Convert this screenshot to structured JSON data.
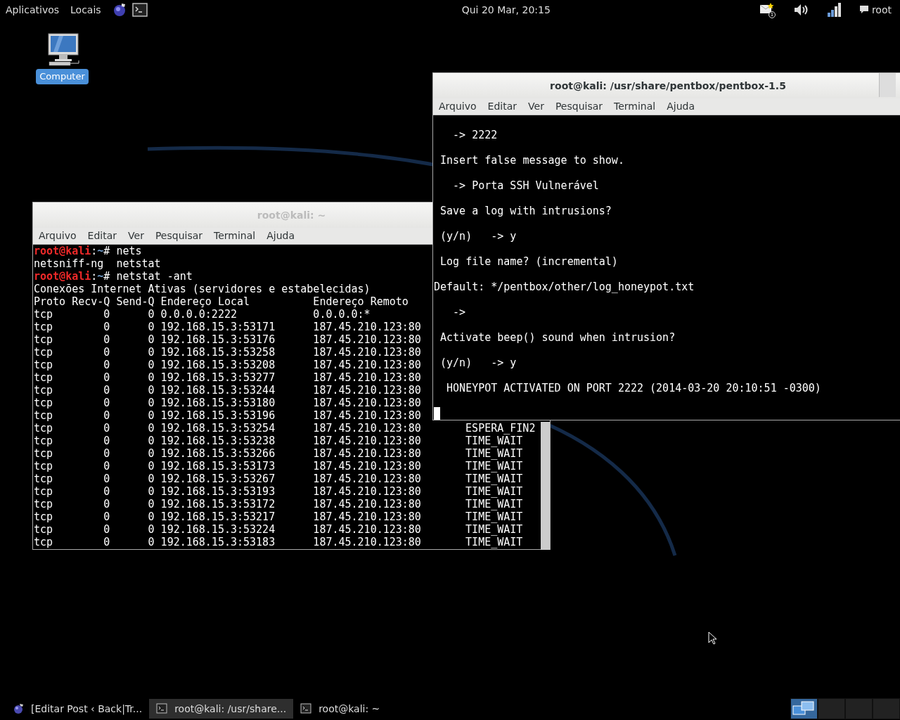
{
  "top_bar": {
    "menus": [
      {
        "label": "Aplicativos"
      },
      {
        "label": "Locais"
      }
    ],
    "clock": "Qui 20 Mar, 20:15",
    "mail_badge": "1",
    "user": "root"
  },
  "desktop_icons": [
    {
      "label": "Computer",
      "selected": true
    }
  ],
  "windows": [
    {
      "title": "root@kali: ~",
      "focused": false,
      "menu": [
        "Arquivo",
        "Editar",
        "Ver",
        "Pesquisar",
        "Terminal",
        "Ajuda"
      ],
      "cursor": false,
      "lines": [
        {
          "kind": "prompt",
          "user": "root@kali",
          "sep": ":",
          "path": "~",
          "symbol": "#",
          "command": " nets"
        },
        {
          "kind": "output",
          "text": "netsniff-ng  netstat"
        },
        {
          "kind": "prompt",
          "user": "root@kali",
          "sep": ":",
          "path": "~",
          "symbol": "#",
          "command": " netstat -ant"
        },
        {
          "kind": "output",
          "text": "Conexões Internet Ativas (servidores e estabelecidas)"
        },
        {
          "kind": "output",
          "text": "Proto Recv-Q Send-Q Endereço Local          Endereço Remoto"
        },
        {
          "kind": "output",
          "text": "tcp        0      0 0.0.0.0:2222            0.0.0.0:*"
        },
        {
          "kind": "output",
          "text": "tcp        0      0 192.168.15.3:53171      187.45.210.123:80"
        },
        {
          "kind": "output",
          "text": "tcp        0      0 192.168.15.3:53176      187.45.210.123:80"
        },
        {
          "kind": "output",
          "text": "tcp        0      0 192.168.15.3:53258      187.45.210.123:80"
        },
        {
          "kind": "output",
          "text": "tcp        0      0 192.168.15.3:53208      187.45.210.123:80"
        },
        {
          "kind": "output",
          "text": "tcp        0      0 192.168.15.3:53277      187.45.210.123:80"
        },
        {
          "kind": "output",
          "text": "tcp        0      0 192.168.15.3:53244      187.45.210.123:80"
        },
        {
          "kind": "output",
          "text": "tcp        0      0 192.168.15.3:53180      187.45.210.123:80"
        },
        {
          "kind": "output",
          "text": "tcp        0      0 192.168.15.3:53196      187.45.210.123:80"
        },
        {
          "kind": "output",
          "text": "tcp        0      0 192.168.15.3:53254      187.45.210.123:80       ESPERA_FIN2"
        },
        {
          "kind": "output",
          "text": "tcp        0      0 192.168.15.3:53238      187.45.210.123:80       TIME_WAIT"
        },
        {
          "kind": "output",
          "text": "tcp        0      0 192.168.15.3:53266      187.45.210.123:80       TIME_WAIT"
        },
        {
          "kind": "output",
          "text": "tcp        0      0 192.168.15.3:53173      187.45.210.123:80       TIME_WAIT"
        },
        {
          "kind": "output",
          "text": "tcp        0      0 192.168.15.3:53267      187.45.210.123:80       TIME_WAIT"
        },
        {
          "kind": "output",
          "text": "tcp        0      0 192.168.15.3:53193      187.45.210.123:80       TIME_WAIT"
        },
        {
          "kind": "output",
          "text": "tcp        0      0 192.168.15.3:53172      187.45.210.123:80       TIME_WAIT"
        },
        {
          "kind": "output",
          "text": "tcp        0      0 192.168.15.3:53217      187.45.210.123:80       TIME_WAIT"
        },
        {
          "kind": "output",
          "text": "tcp        0      0 192.168.15.3:53224      187.45.210.123:80       TIME_WAIT"
        },
        {
          "kind": "output",
          "text": "tcp        0      0 192.168.15.3:53183      187.45.210.123:80       TIME_WAIT"
        }
      ]
    },
    {
      "title": "root@kali: /usr/share/pentbox/pentbox-1.5",
      "focused": true,
      "menu": [
        "Arquivo",
        "Editar",
        "Ver",
        "Pesquisar",
        "Terminal",
        "Ajuda"
      ],
      "cursor": true,
      "lines": [
        {
          "kind": "output",
          "text": "   -> 2222"
        },
        {
          "kind": "output",
          "text": " Insert false message to show."
        },
        {
          "kind": "output",
          "text": "   -> Porta SSH Vulnerável"
        },
        {
          "kind": "output",
          "text": " Save a log with intrusions?"
        },
        {
          "kind": "output",
          "text": " (y/n)   -> y"
        },
        {
          "kind": "output",
          "text": " Log file name? (incremental)"
        },
        {
          "kind": "output",
          "text": "Default: */pentbox/other/log_honeypot.txt"
        },
        {
          "kind": "output",
          "text": "   ->"
        },
        {
          "kind": "output",
          "text": " Activate beep() sound when intrusion?"
        },
        {
          "kind": "output",
          "text": " (y/n)   -> y"
        },
        {
          "kind": "output",
          "text": "  HONEYPOT ACTIVATED ON PORT 2222 (2014-03-20 20:10:51 -0300)"
        }
      ]
    }
  ],
  "taskbar": {
    "items": [
      {
        "label": "[Editar Post ‹ Back|Tr...",
        "kind": "browser",
        "selected": false
      },
      {
        "label": "root@kali: /usr/share...",
        "kind": "terminal",
        "selected": true
      },
      {
        "label": "root@kali: ~",
        "kind": "terminal",
        "selected": false
      }
    ],
    "workspaces": [
      {
        "selected": true
      },
      {
        "selected": false
      },
      {
        "selected": false
      },
      {
        "selected": false
      }
    ]
  }
}
